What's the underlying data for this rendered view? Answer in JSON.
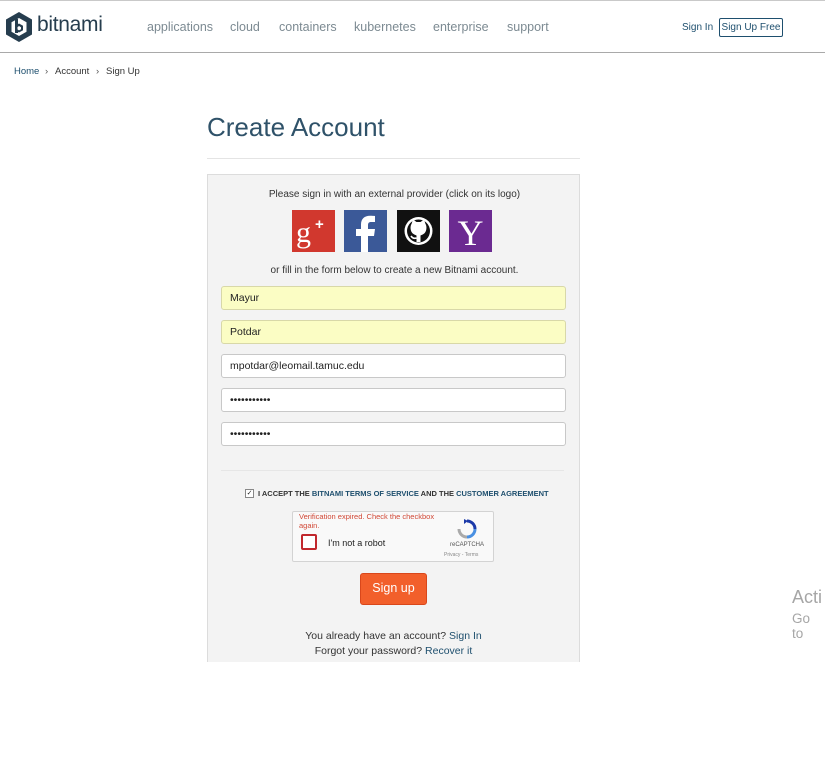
{
  "header": {
    "logo_text": "bitnami",
    "nav": [
      "applications",
      "cloud",
      "containers",
      "kubernetes",
      "enterprise",
      "support"
    ],
    "sign_in": "Sign In",
    "sign_up": "Sign Up Free"
  },
  "breadcrumb": {
    "home": "Home",
    "account": "Account",
    "current": "Sign Up",
    "separator": "›"
  },
  "page_title": "Create Account",
  "form": {
    "external_prompt": "Please sign in with an external provider (click on its logo)",
    "providers": [
      "google-plus",
      "facebook",
      "github",
      "yahoo"
    ],
    "fill_prompt": "or fill in the form below to create a new Bitnami account.",
    "first_name": "Mayur",
    "last_name": "Potdar",
    "email": "mpotdar@leomail.tamuc.edu",
    "password": "•••••••••••",
    "password_confirm": "•••••••••••",
    "terms": {
      "checked": true,
      "prefix": "I ACCEPT THE ",
      "tos_link": "BITNAMI TERMS OF SERVICE",
      "middle": " AND THE ",
      "agreement_link": "CUSTOMER AGREEMENT"
    },
    "captcha": {
      "error": "Verification expired. Check the checkbox again.",
      "label": "I'm not a robot",
      "brand": "reCAPTCHA",
      "links": "Privacy - Terms"
    },
    "submit": "Sign up",
    "have_account": "You already have an account?",
    "sign_in_link": "Sign In",
    "forgot": "Forgot your password?",
    "recover_link": "Recover it"
  },
  "windows_watermark": {
    "line1": "Acti",
    "line2": "Go to"
  },
  "colors": {
    "accent": "#f25f2b",
    "link": "#1e4f6e",
    "title": "#2f5269",
    "google": "#d1382e",
    "facebook": "#3b5998",
    "github": "#111111",
    "yahoo": "#6b2a91"
  }
}
